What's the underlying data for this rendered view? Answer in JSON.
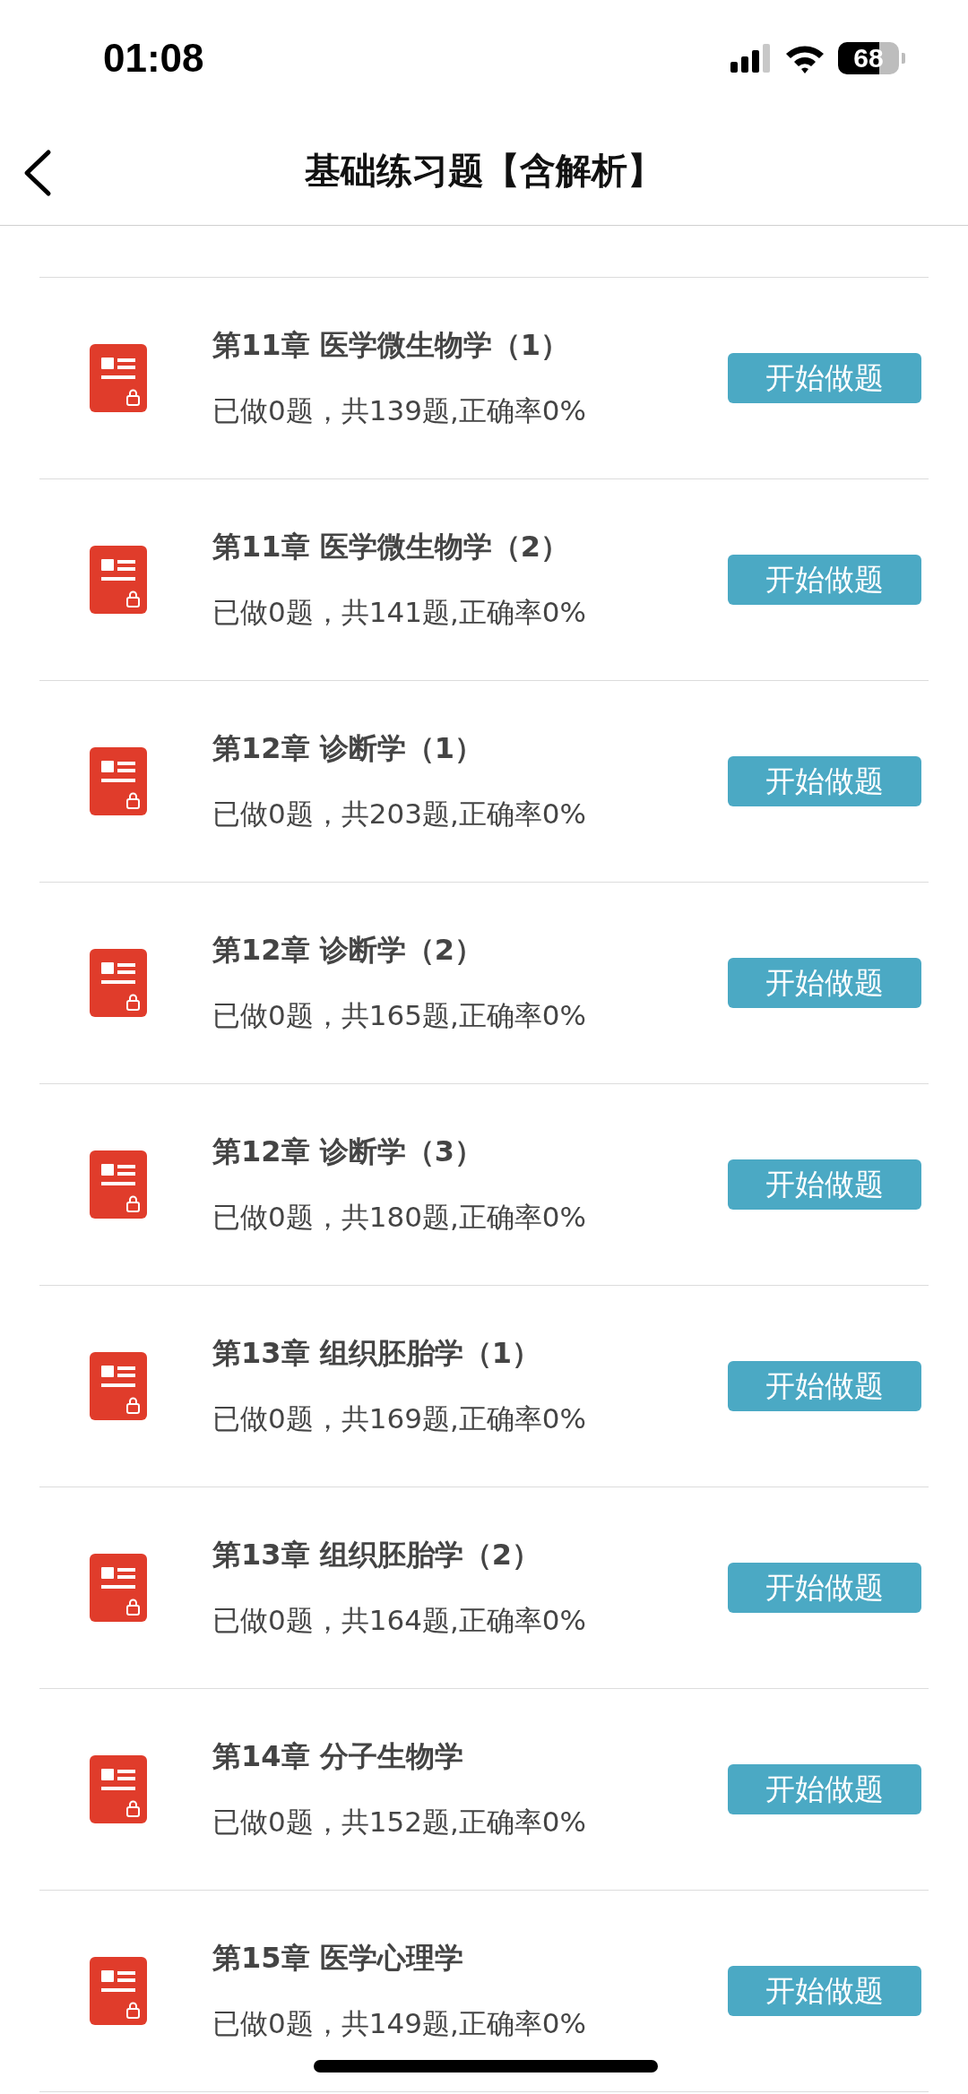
{
  "status_bar": {
    "time": "01:08",
    "battery": "68"
  },
  "header": {
    "title": "基础练习题【含解析】"
  },
  "chapters": [
    {
      "title": "第11章 医学微生物学（1）",
      "progress": "已做0题，共139题,正确率0%",
      "button": "开始做题"
    },
    {
      "title": "第11章 医学微生物学（2）",
      "progress": "已做0题，共141题,正确率0%",
      "button": "开始做题"
    },
    {
      "title": "第12章 诊断学（1）",
      "progress": "已做0题，共203题,正确率0%",
      "button": "开始做题"
    },
    {
      "title": "第12章 诊断学（2）",
      "progress": "已做0题，共165题,正确率0%",
      "button": "开始做题"
    },
    {
      "title": "第12章 诊断学（3）",
      "progress": "已做0题，共180题,正确率0%",
      "button": "开始做题"
    },
    {
      "title": "第13章 组织胚胎学（1）",
      "progress": "已做0题，共169题,正确率0%",
      "button": "开始做题"
    },
    {
      "title": "第13章 组织胚胎学（2）",
      "progress": "已做0题，共164题,正确率0%",
      "button": "开始做题"
    },
    {
      "title": "第14章 分子生物学",
      "progress": "已做0题，共152题,正确率0%",
      "button": "开始做题"
    },
    {
      "title": "第15章 医学心理学",
      "progress": "已做0题，共149题,正确率0%",
      "button": "开始做题"
    }
  ]
}
